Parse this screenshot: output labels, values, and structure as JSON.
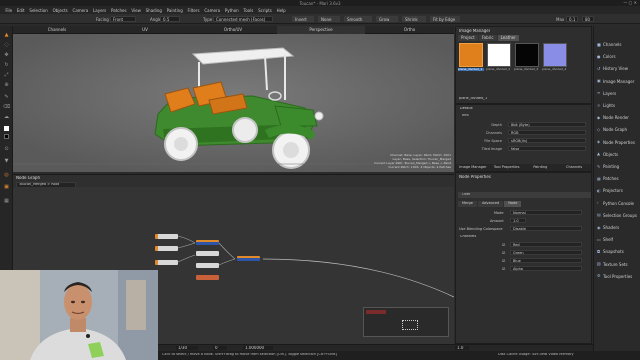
{
  "window": {
    "title": "Toucan* - Mari 3.6v3"
  },
  "menu": [
    "File",
    "Edit",
    "Selection",
    "Objects",
    "Camera",
    "Layers",
    "Patches",
    "View",
    "Shading",
    "Painting",
    "Filters",
    "Camera",
    "Python",
    "Tools",
    "Scripts",
    "Help"
  ],
  "tool_options": {
    "facing_label": "Facing",
    "facing_value": "Front",
    "angle_label": "Angle",
    "angle_value": "0.5",
    "type_label": "Type",
    "type_value": "Connected mesh (Faces)",
    "buttons": [
      "Invert",
      "None",
      "Smooth",
      "Grow",
      "Shrink",
      "Fit by Edge"
    ],
    "max_label": "Max",
    "max_value": "0.1",
    "percent_value": "80"
  },
  "viewport_tabs": [
    "Channels",
    "UV",
    "Ortho/UV",
    "Perspective",
    "Ortho"
  ],
  "viewport_info": [
    "Channel: Base, Layer: Paint, Patch: 1001",
    "Layer: Base, Selection: Toucan_Merged",
    "Current Layer Path: Toucan_Merged > Base > Paint",
    "Current Patch: 1003, 4 Objects: 4 Patches"
  ],
  "image_manager": {
    "title": "Image Manager",
    "tabs": [
      "Project",
      "Fabric",
      "Leather"
    ],
    "thumbs": [
      {
        "label": "plane_divided_1",
        "color": "#e0801c"
      },
      {
        "label": "plane_divided_2",
        "color": "#ffffff"
      },
      {
        "label": "plane_divided_3",
        "color": "#050505"
      },
      {
        "label": "plane_divided_4",
        "color": "#8a8de6"
      }
    ],
    "selected_label": "plane_divided_1"
  },
  "image_props": {
    "section_default": "Default",
    "section_info": "Info",
    "rows": [
      {
        "k": "Depth",
        "v": "8bit (Byte)"
      },
      {
        "k": "Channels",
        "v": "RGB"
      },
      {
        "k": "File Space",
        "v": "sRGB(lin)"
      },
      {
        "k": "Tiled Image",
        "v": "false"
      }
    ],
    "bottom_tabs": [
      "Image Manager",
      "Tool Properties",
      "Painting",
      "Channels"
    ]
  },
  "right_dock": [
    {
      "label": "Channels",
      "icon": "■"
    },
    {
      "label": "Colors",
      "icon": "●"
    },
    {
      "label": "History View",
      "icon": "↺"
    },
    {
      "label": "Image Manager",
      "icon": "▣"
    },
    {
      "label": "Layers",
      "icon": "≡"
    },
    {
      "label": "Lights",
      "icon": "☼"
    },
    {
      "label": "Node Render",
      "icon": "◆"
    },
    {
      "label": "Node Graph",
      "icon": "◇"
    },
    {
      "label": "Node Properties",
      "icon": "◈"
    },
    {
      "label": "Objects",
      "icon": "▲"
    },
    {
      "label": "Painting",
      "icon": "✎"
    },
    {
      "label": "Patches",
      "icon": "▦"
    },
    {
      "label": "Projectors",
      "icon": "◐"
    },
    {
      "label": "Python Console",
      "icon": "›"
    },
    {
      "label": "Selection Groups",
      "icon": "▤"
    },
    {
      "label": "Shaders",
      "icon": "◉"
    },
    {
      "label": "Shelf",
      "icon": "▭"
    },
    {
      "label": "Snapshots",
      "icon": "◘"
    },
    {
      "label": "Texture Sets",
      "icon": "▧"
    },
    {
      "label": "Tool Properties",
      "icon": "⚙"
    }
  ],
  "node_graph": {
    "title": "Node Graph",
    "breadcrumb": "Toucan_Merged > Root"
  },
  "node_props": {
    "title": "Node Properties",
    "node_name": "Over",
    "tabs": [
      "Merge",
      "Advanced",
      "Node"
    ],
    "rows": [
      {
        "k": "Mode",
        "v": "Normal"
      },
      {
        "k": "Amount",
        "v": "1.0"
      },
      {
        "k": "Use Blending Colorspace",
        "v": "Disable"
      }
    ],
    "section": "Channels",
    "channels": [
      "Red",
      "Green",
      "Blue",
      "Alpha"
    ]
  },
  "timeline": {
    "frame_start": "1/30",
    "frame": "0",
    "frame_end": "1.000000",
    "zoom": "1.0"
  },
  "status": {
    "left": "Click to select / move a node. Shift+drag to move from selection [Ctrl]. Toggle selection [Ctrl+Shift]",
    "right": "Disk Cache Usage: 449.0MB  Video Memory"
  }
}
